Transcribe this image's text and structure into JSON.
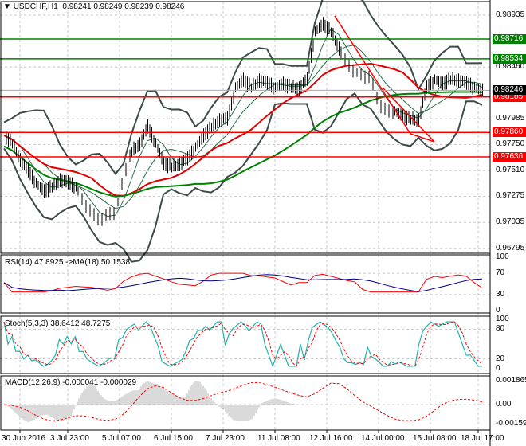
{
  "header": {
    "symbol": "USDCHF,H1",
    "open": "0.98241",
    "high": "0.98249",
    "low": "0.98239",
    "close": "0.98246"
  },
  "price_axis": [
    "0.98935",
    "0.98460",
    "0.97985",
    "0.97750",
    "0.97510",
    "0.97275",
    "0.97035",
    "0.96795"
  ],
  "levels": [
    {
      "value": 0.98716,
      "label": "0.98716",
      "color": "#008000"
    },
    {
      "value": 0.98534,
      "label": "0.98534",
      "color": "#008000"
    },
    {
      "value": 0.98185,
      "label": "0.98185",
      "color": "#ff0000"
    },
    {
      "value": 0.9786,
      "label": "0.97860",
      "color": "#ff0000"
    },
    {
      "value": 0.97636,
      "label": "0.97636",
      "color": "#ff0000"
    }
  ],
  "current": {
    "value": 0.98246,
    "label": "0.98246"
  },
  "closes": [
    0.97833,
    0.9776,
    0.97614,
    0.97504,
    0.97395,
    0.97322,
    0.97358,
    0.97431,
    0.97395,
    0.97358,
    0.97212,
    0.97103,
    0.97066,
    0.97103,
    0.97139,
    0.97468,
    0.97687,
    0.9776,
    0.97906,
    0.9776,
    0.97577,
    0.97541,
    0.97577,
    0.97614,
    0.97723,
    0.97833,
    0.97906,
    0.97979,
    0.97979,
    0.98271,
    0.98344,
    0.98271,
    0.98344,
    0.98307,
    0.98271,
    0.98307,
    0.98271,
    0.98271,
    0.98344,
    0.98782,
    0.98855,
    0.98782,
    0.98636,
    0.9849,
    0.98417,
    0.9838,
    0.98344,
    0.98125,
    0.98052,
    0.98052,
    0.98015,
    0.97979,
    0.97979,
    0.98271,
    0.98344,
    0.98307,
    0.98344,
    0.98344,
    0.98307,
    0.98271,
    0.98246
  ],
  "rsi": {
    "label": "RSI(14) 47.8925  ->MA(18) 50.1538",
    "axis": [
      "100",
      "70",
      "30",
      "0"
    ]
  },
  "stoch": {
    "label": "Stoch(5,3,3) 38.6412 48.7275",
    "axis": [
      "100",
      "80",
      "20",
      "0"
    ]
  },
  "macd": {
    "label": "MACD(12,26,9) -0.000041 -0.000029",
    "axis": [
      "0.001865",
      "0.00",
      "-0.001595"
    ]
  },
  "time_axis": [
    "30 Jun 2016",
    "3 Jul 23:00",
    "5 Jul 07:00",
    "6 Jul 15:00",
    "7 Jul 23:00",
    "11 Jul 08:00",
    "12 Jul 16:00",
    "14 Jul 00:00",
    "15 Jul 08:00",
    "18 Jul 17:00"
  ]
}
